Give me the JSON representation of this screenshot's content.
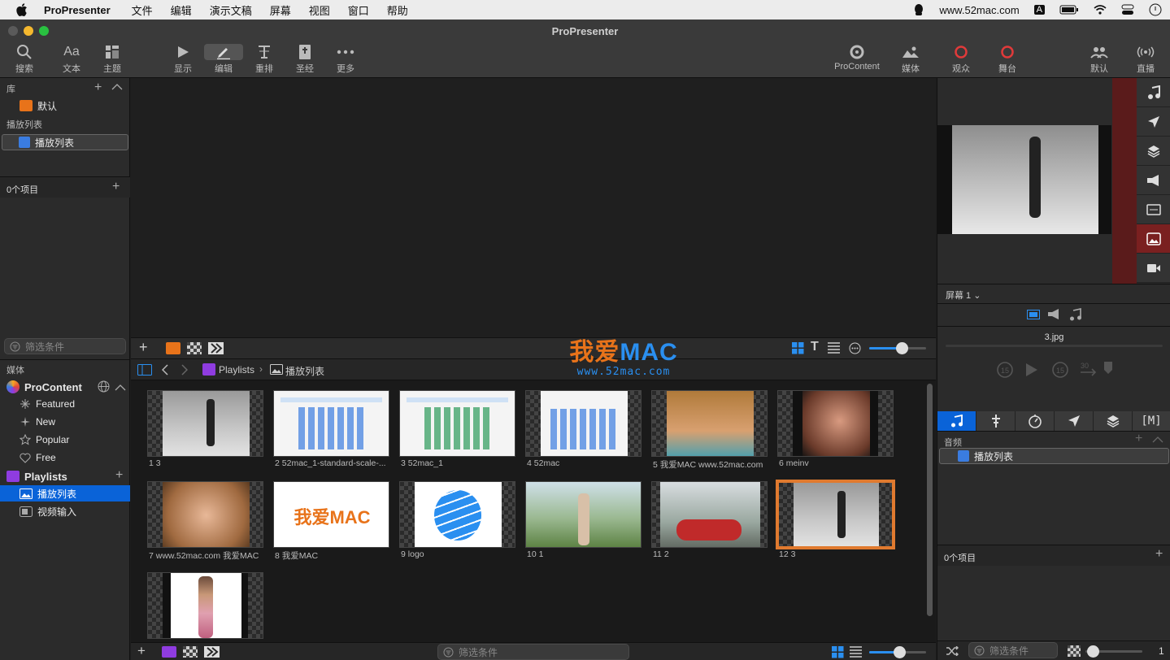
{
  "menubar": {
    "app_name": "ProPresenter",
    "items": [
      "文件",
      "编辑",
      "演示文稿",
      "屏幕",
      "视图",
      "窗口",
      "帮助"
    ],
    "url": "www.52mac.com",
    "input_indicator": "A"
  },
  "window": {
    "title": "ProPresenter"
  },
  "toolbar": {
    "left": [
      {
        "label": "搜索",
        "icon": "search-icon"
      },
      {
        "label": "文本",
        "icon": "text-icon"
      },
      {
        "label": "主题",
        "icon": "theme-icon"
      }
    ],
    "center": [
      {
        "label": "显示",
        "icon": "play-icon"
      },
      {
        "label": "编辑",
        "icon": "pencil-icon"
      },
      {
        "label": "重排",
        "icon": "reflow-icon"
      },
      {
        "label": "圣经",
        "icon": "bible-icon"
      },
      {
        "label": "更多",
        "icon": "more-icon"
      }
    ],
    "right": [
      {
        "label": "ProContent",
        "icon": "procontent-icon"
      },
      {
        "label": "媒体",
        "icon": "media-icon"
      },
      {
        "label": "观众",
        "icon": "audience-icon"
      },
      {
        "label": "舞台",
        "icon": "stage-icon"
      },
      {
        "label": "默认",
        "icon": "default-icon"
      },
      {
        "label": "直播",
        "icon": "broadcast-icon"
      }
    ]
  },
  "library": {
    "header": "库",
    "default_item": "默认",
    "playlist_header": "播放列表",
    "playlist_item": "播放列表",
    "items_count": "0个项目",
    "filter_placeholder": "筛选条件"
  },
  "media_panel": {
    "header": "媒体",
    "procontent": "ProContent",
    "procontent_items": [
      "Featured",
      "New",
      "Popular",
      "Free"
    ],
    "playlists": "Playlists",
    "playlist_items": [
      "播放列表",
      "视频输入"
    ]
  },
  "breadcrumb": {
    "root": "Playlists",
    "current": "播放列表"
  },
  "watermark": {
    "big_cn": "我爱",
    "big_en": "MAC",
    "small": "www.52mac.com"
  },
  "slides": [
    {
      "num": "1",
      "name": "3"
    },
    {
      "num": "2",
      "name": "52mac_1-standard-scale-..."
    },
    {
      "num": "3",
      "name": "52mac_1"
    },
    {
      "num": "4",
      "name": "52mac"
    },
    {
      "num": "5",
      "name": "我爱MAC  www.52mac.com"
    },
    {
      "num": "6",
      "name": "meinv"
    },
    {
      "num": "7",
      "name": "www.52mac.com 我爱MAC"
    },
    {
      "num": "8",
      "name": "我爱MAC"
    },
    {
      "num": "9",
      "name": "logo"
    },
    {
      "num": "10",
      "name": "1"
    },
    {
      "num": "11",
      "name": "2"
    },
    {
      "num": "12",
      "name": "3"
    },
    {
      "num": "",
      "name": ""
    }
  ],
  "slide8_logo": "我爱MAC",
  "bottom_filter_placeholder": "筛选条件",
  "right_panel": {
    "screen_label": "屏幕 1",
    "media_file": "3.jpg",
    "audio_header": "音频",
    "audio_item": "播放列表",
    "items_count": "0个项目",
    "filter_placeholder": "筛选条件",
    "zoom_value": "1",
    "skip_back": "15",
    "skip_fwd": "15",
    "skip_fwd2": "30",
    "tab_m": "[M]"
  },
  "colors": {
    "accent": "#0a63d8",
    "selected_slide_border": "#e07a2f",
    "side_strip": "#5a1b1b",
    "watermark_orange": "#e8731a",
    "watermark_blue": "#2a8ff0"
  }
}
